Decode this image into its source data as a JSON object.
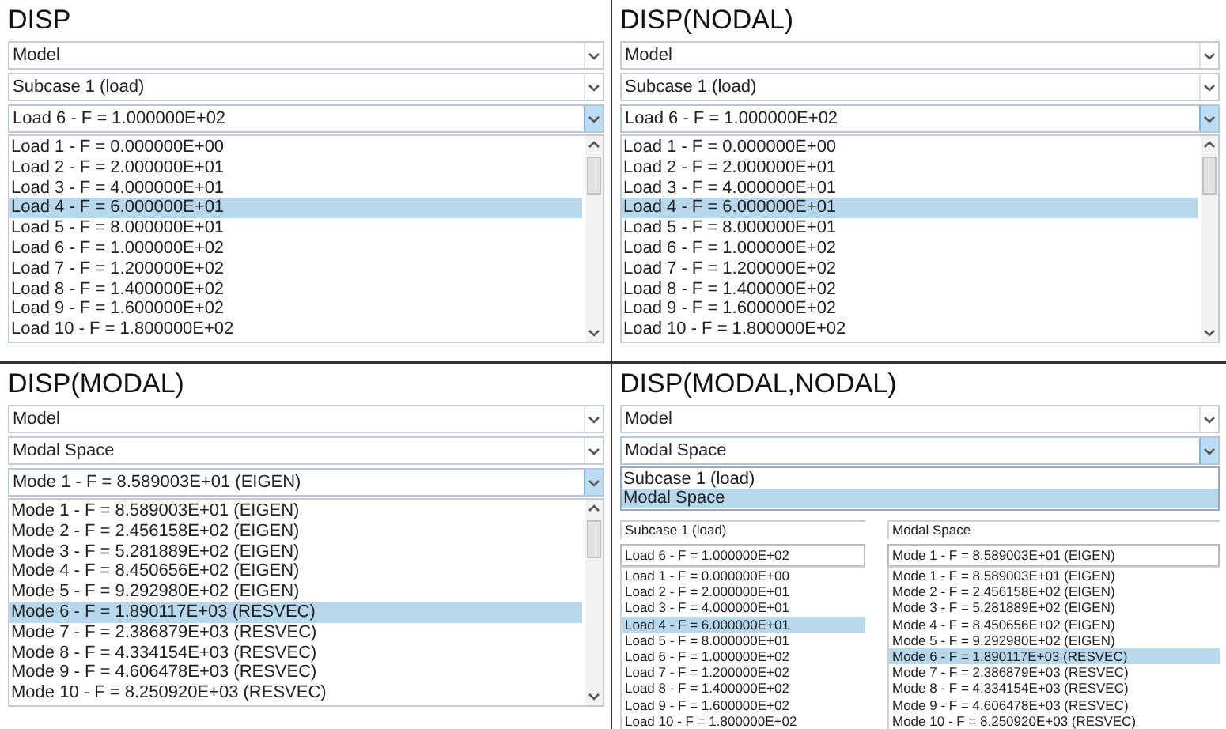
{
  "panels": [
    {
      "kind": "standard",
      "title": "DISP",
      "fields": [
        {
          "value": "Model",
          "open": false
        },
        {
          "value": "Subcase 1 (load)",
          "open": false
        },
        {
          "value": "Load 6 - F = 1.000000E+02",
          "open": true
        }
      ],
      "list": [
        {
          "label": "Load 1 - F = 0.000000E+00",
          "selected": false
        },
        {
          "label": "Load 2 - F = 2.000000E+01",
          "selected": false
        },
        {
          "label": "Load 3 - F = 4.000000E+01",
          "selected": false
        },
        {
          "label": "Load 4 - F = 6.000000E+01",
          "selected": true
        },
        {
          "label": "Load 5 - F = 8.000000E+01",
          "selected": false
        },
        {
          "label": "Load 6 - F = 1.000000E+02",
          "selected": false
        },
        {
          "label": "Load 7 - F = 1.200000E+02",
          "selected": false
        },
        {
          "label": "Load 8 - F = 1.400000E+02",
          "selected": false
        },
        {
          "label": "Load 9 - F = 1.600000E+02",
          "selected": false
        },
        {
          "label": "Load 10 - F = 1.800000E+02",
          "selected": false
        }
      ]
    },
    {
      "kind": "standard",
      "title": "DISP(NODAL)",
      "fields": [
        {
          "value": "Model",
          "open": false
        },
        {
          "value": "Subcase 1 (load)",
          "open": false
        },
        {
          "value": "Load 6 - F = 1.000000E+02",
          "open": true
        }
      ],
      "list": [
        {
          "label": "Load 1 - F = 0.000000E+00",
          "selected": false
        },
        {
          "label": "Load 2 - F = 2.000000E+01",
          "selected": false
        },
        {
          "label": "Load 3 - F = 4.000000E+01",
          "selected": false
        },
        {
          "label": "Load 4 - F = 6.000000E+01",
          "selected": true
        },
        {
          "label": "Load 5 - F = 8.000000E+01",
          "selected": false
        },
        {
          "label": "Load 6 - F = 1.000000E+02",
          "selected": false
        },
        {
          "label": "Load 7 - F = 1.200000E+02",
          "selected": false
        },
        {
          "label": "Load 8 - F = 1.400000E+02",
          "selected": false
        },
        {
          "label": "Load 9 - F = 1.600000E+02",
          "selected": false
        },
        {
          "label": "Load 10 - F = 1.800000E+02",
          "selected": false
        }
      ]
    },
    {
      "kind": "standard",
      "title": "DISP(MODAL)",
      "fields": [
        {
          "value": "Model",
          "open": false
        },
        {
          "value": "Modal Space",
          "open": false
        },
        {
          "value": "Mode 1 - F = 8.589003E+01 (EIGEN)",
          "open": true
        }
      ],
      "list": [
        {
          "label": "Mode 1 - F = 8.589003E+01 (EIGEN)",
          "selected": false
        },
        {
          "label": "Mode 2 - F = 2.456158E+02 (EIGEN)",
          "selected": false
        },
        {
          "label": "Mode 3 - F = 5.281889E+02 (EIGEN)",
          "selected": false
        },
        {
          "label": "Mode 4 - F = 8.450656E+02 (EIGEN)",
          "selected": false
        },
        {
          "label": "Mode 5 - F = 9.292980E+02 (EIGEN)",
          "selected": false
        },
        {
          "label": "Mode 6 - F = 1.890117E+03 (RESVEC)",
          "selected": true
        },
        {
          "label": "Mode 7 - F = 2.386879E+03 (RESVEC)",
          "selected": false
        },
        {
          "label": "Mode 8 - F = 4.334154E+03 (RESVEC)",
          "selected": false
        },
        {
          "label": "Mode 9 - F = 4.606478E+03 (RESVEC)",
          "selected": false
        },
        {
          "label": "Mode 10 - F = 8.250920E+03 (RESVEC)",
          "selected": false
        }
      ]
    },
    {
      "kind": "combined",
      "title": "DISP(MODAL,NODAL)",
      "fields": [
        {
          "value": "Model",
          "open": false
        },
        {
          "value": "Modal Space",
          "open": true
        }
      ],
      "options": [
        {
          "label": "Subcase 1 (load)",
          "selected": false
        },
        {
          "label": "Modal Space",
          "selected": true
        }
      ],
      "subpanels": [
        {
          "header": "Subcase 1 (load)",
          "field": "Load 6 - F = 1.000000E+02",
          "list": [
            {
              "label": "Load 1 - F = 0.000000E+00",
              "selected": false
            },
            {
              "label": "Load 2 - F = 2.000000E+01",
              "selected": false
            },
            {
              "label": "Load 3 - F = 4.000000E+01",
              "selected": false
            },
            {
              "label": "Load 4 - F = 6.000000E+01",
              "selected": true
            },
            {
              "label": "Load 5 - F = 8.000000E+01",
              "selected": false
            },
            {
              "label": "Load 6 - F = 1.000000E+02",
              "selected": false
            },
            {
              "label": "Load 7 - F = 1.200000E+02",
              "selected": false
            },
            {
              "label": "Load 8 - F = 1.400000E+02",
              "selected": false
            },
            {
              "label": "Load 9 - F = 1.600000E+02",
              "selected": false
            },
            {
              "label": "Load 10 - F = 1.800000E+02",
              "selected": false
            }
          ]
        },
        {
          "header": "Modal Space",
          "field": "Mode 1 - F = 8.589003E+01 (EIGEN)",
          "list": [
            {
              "label": "Mode 1 - F = 8.589003E+01 (EIGEN)",
              "selected": false
            },
            {
              "label": "Mode 2 - F = 2.456158E+02 (EIGEN)",
              "selected": false
            },
            {
              "label": "Mode 3 - F = 5.281889E+02 (EIGEN)",
              "selected": false
            },
            {
              "label": "Mode 4 - F = 8.450656E+02 (EIGEN)",
              "selected": false
            },
            {
              "label": "Mode 5 - F = 9.292980E+02 (EIGEN)",
              "selected": false
            },
            {
              "label": "Mode 6 - F = 1.890117E+03 (RESVEC)",
              "selected": true
            },
            {
              "label": "Mode 7 - F = 2.386879E+03 (RESVEC)",
              "selected": false
            },
            {
              "label": "Mode 8 - F = 4.334154E+03 (RESVEC)",
              "selected": false
            },
            {
              "label": "Mode 9 - F = 4.606478E+03 (RESVEC)",
              "selected": false
            },
            {
              "label": "Mode 10 - F = 8.250920E+03 (RESVEC)",
              "selected": false
            }
          ]
        }
      ]
    }
  ]
}
